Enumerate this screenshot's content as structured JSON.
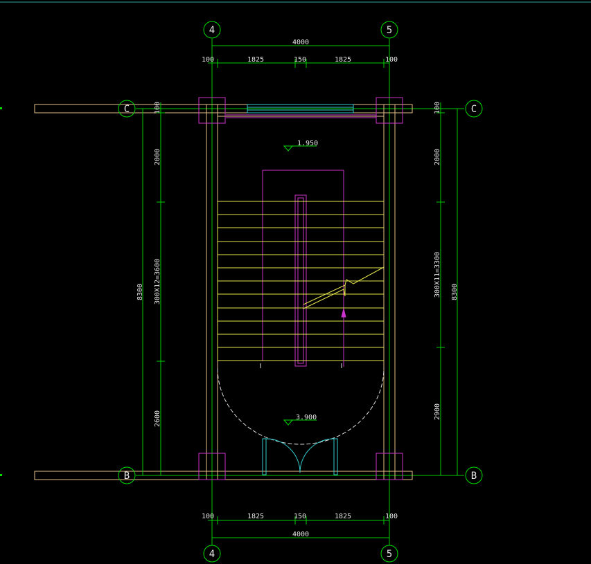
{
  "colors": {
    "background": "#000000",
    "dimension": "#00cc00",
    "wall": "#e6c08a",
    "column": "#cc33cc",
    "stair": "#e6e64d",
    "window": "#33cccc",
    "swing": "#dddddd",
    "text": "#e8e8e8",
    "axis": "#00dd00"
  },
  "axes": {
    "vertical": [
      "4",
      "5"
    ],
    "horizontal": [
      "C",
      "B"
    ]
  },
  "top_dims": {
    "total": "4000",
    "segments": [
      "100",
      "1825",
      "150",
      "1825",
      "100"
    ]
  },
  "bottom_dims": {
    "total": "4000",
    "segments": [
      "100",
      "1825",
      "150",
      "1825",
      "100"
    ]
  },
  "left_dims": {
    "total": "8300",
    "segments": [
      "100",
      "2000",
      "300X12=3600",
      "2600"
    ]
  },
  "right_dims": {
    "total": "8300",
    "segments": [
      "100",
      "2000",
      "300X11=3300",
      "2900"
    ]
  },
  "levels": {
    "upper": "1.950",
    "lower": "3.900"
  }
}
